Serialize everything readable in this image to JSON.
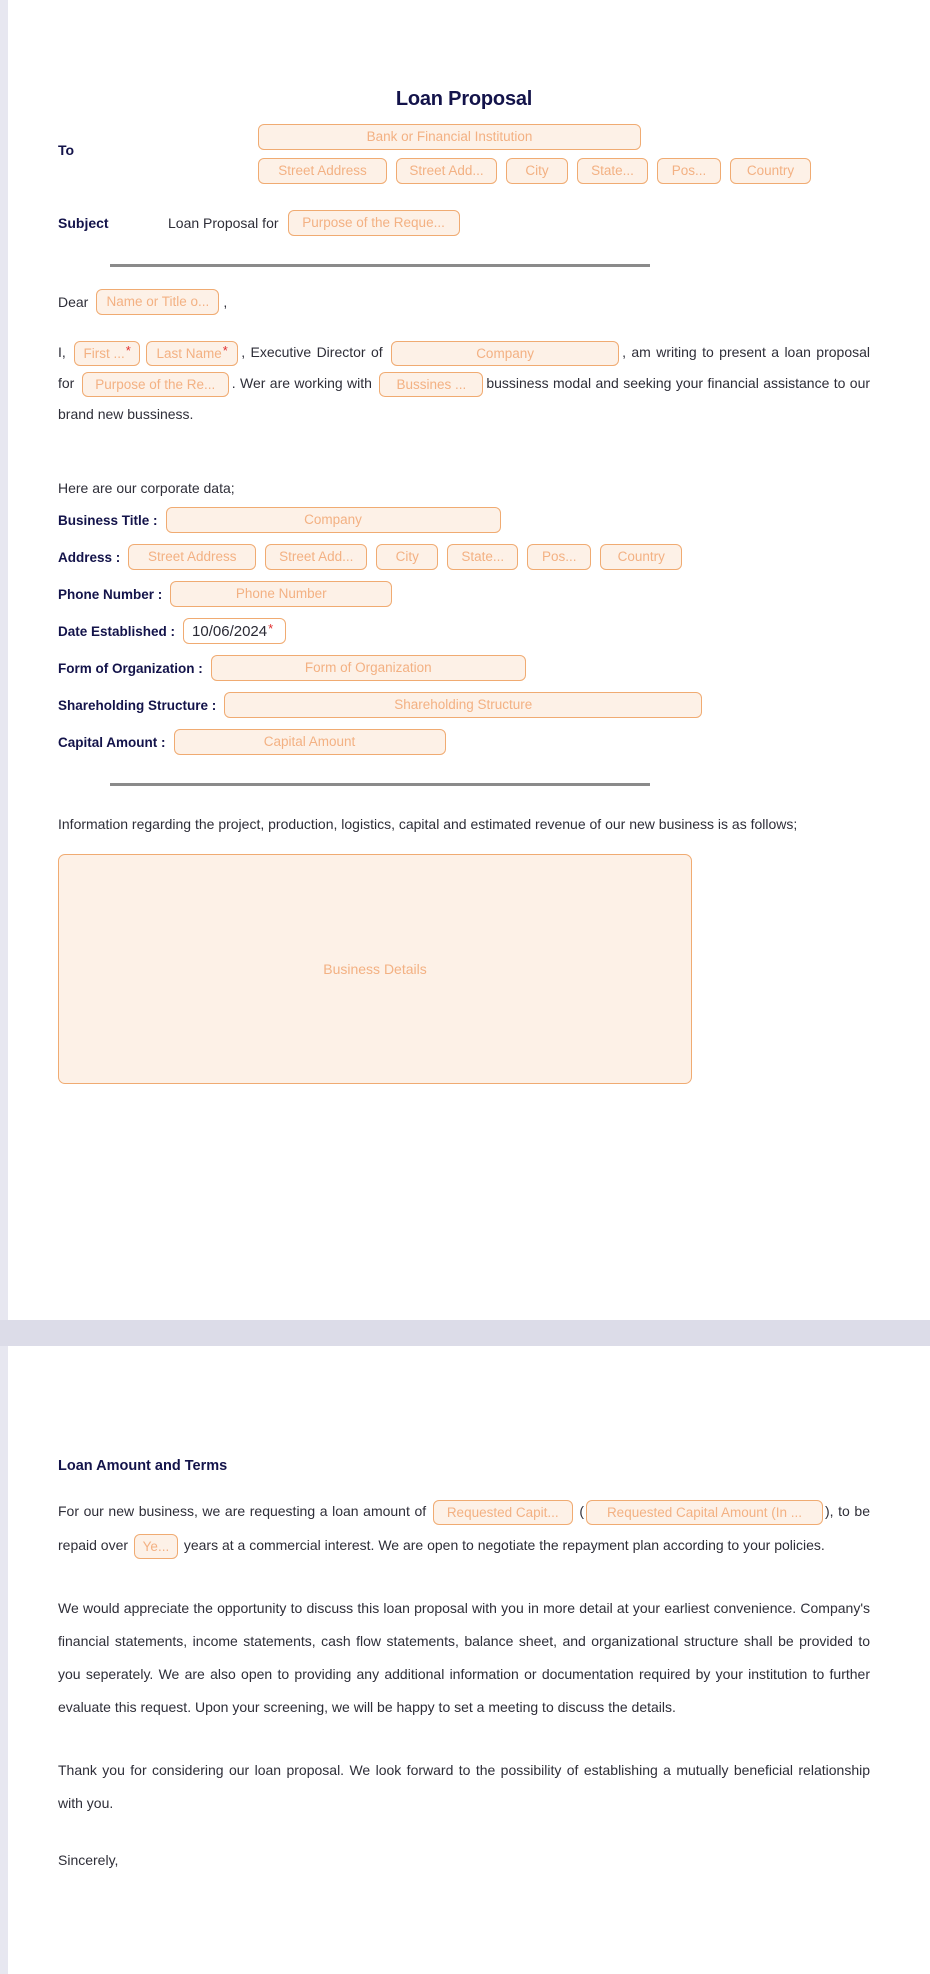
{
  "document": {
    "title": "Loan Proposal",
    "to_label": "To",
    "subject_label": "Subject",
    "subject_prefix": "Loan Proposal for",
    "dear_label": "Dear",
    "dear_comma": ","
  },
  "recipient": {
    "institution_placeholder": "Bank or Financial Institution",
    "address": [
      {
        "name": "street-address-1",
        "placeholder": "Street Address"
      },
      {
        "name": "street-address-2",
        "placeholder": "Street Add..."
      },
      {
        "name": "city",
        "placeholder": "City"
      },
      {
        "name": "state",
        "placeholder": "State..."
      },
      {
        "name": "postal-code",
        "placeholder": "Pos..."
      },
      {
        "name": "country",
        "placeholder": "Country"
      }
    ]
  },
  "subject": {
    "purpose_placeholder": "Purpose of the Reque..."
  },
  "salutation": {
    "name_placeholder": "Name or Title o..."
  },
  "intro_paragraph": {
    "t1": "I,",
    "first_name_placeholder": "First ...",
    "last_name_placeholder": "Last Name",
    "t2": ", Executive Director of",
    "company_placeholder": "Company",
    "t3": ", am writing to present a loan proposal for",
    "purpose_placeholder": "Purpose of the Re...",
    "t4": ". Wer are working with",
    "business_model_placeholder": "Bussines ...",
    "t5": "bussiness modal and seeking your financial assistance to our brand new bussiness.",
    "required_marker": "*"
  },
  "corporate": {
    "intro": "Here are our corporate data;",
    "rows": [
      {
        "label": "Business Title :",
        "placeholder": "Company"
      },
      {
        "label": "Address :",
        "placeholder": ""
      },
      {
        "label": "Phone Number :",
        "placeholder": "Phone Number"
      },
      {
        "label": "Date Established :",
        "value": "10/06/2024",
        "required": "*"
      },
      {
        "label": "Form of Organization :",
        "placeholder": "Form of Organization"
      },
      {
        "label": "Shareholding Structure :",
        "placeholder": "Shareholding Structure"
      },
      {
        "label": "Capital Amount :",
        "placeholder": "Capital Amount"
      }
    ],
    "address_fields": [
      {
        "name": "street-address-1",
        "placeholder": "Street Address"
      },
      {
        "name": "street-address-2",
        "placeholder": "Street Add..."
      },
      {
        "name": "city",
        "placeholder": "City"
      },
      {
        "name": "state",
        "placeholder": "State..."
      },
      {
        "name": "postal-code",
        "placeholder": "Pos..."
      },
      {
        "name": "country",
        "placeholder": "Country"
      }
    ]
  },
  "business_info": {
    "paragraph": "Information regarding the project, production, logistics, capital and estimated revenue of our new business is as follows;",
    "details_placeholder": "Business Details"
  },
  "loan_terms": {
    "heading": "Loan Amount and Terms",
    "t1": "For our new business, we are requesting a loan amount of",
    "amount_placeholder": "Requested Capit...",
    "open_paren": "(",
    "amount_words_placeholder": "Requested Capital Amount (In ...",
    "t2": "), to be repaid over",
    "years_placeholder": "Ye...",
    "t3": "years at a commercial interest. We are open to negotiate the repayment plan according to your policies."
  },
  "closing": {
    "paragraph_1": "We would appreciate the opportunity to discuss this loan proposal with you in more detail at your earliest convenience. Company's financial statements, income statements, cash flow statements, balance sheet, and organizational structure shall be provided to you seperately. We are also open to providing any additional information or documentation required by your institution to further evaluate this request. Upon your screening, we will be happy to set a meeting to discuss the details.",
    "paragraph_2": "Thank you for considering our loan proposal. We look forward to the possibility of establishing a mutually beneficial relationship with you.",
    "sincerely": "Sincerely,"
  },
  "colors": {
    "field_border": "#f0ab72",
    "field_fill": "#fdf1e7",
    "field_text": "#f3b183",
    "heading": "#13134a",
    "body_text": "#2e2e38",
    "required": "#e03030",
    "page_background": "#e7e7f0"
  }
}
